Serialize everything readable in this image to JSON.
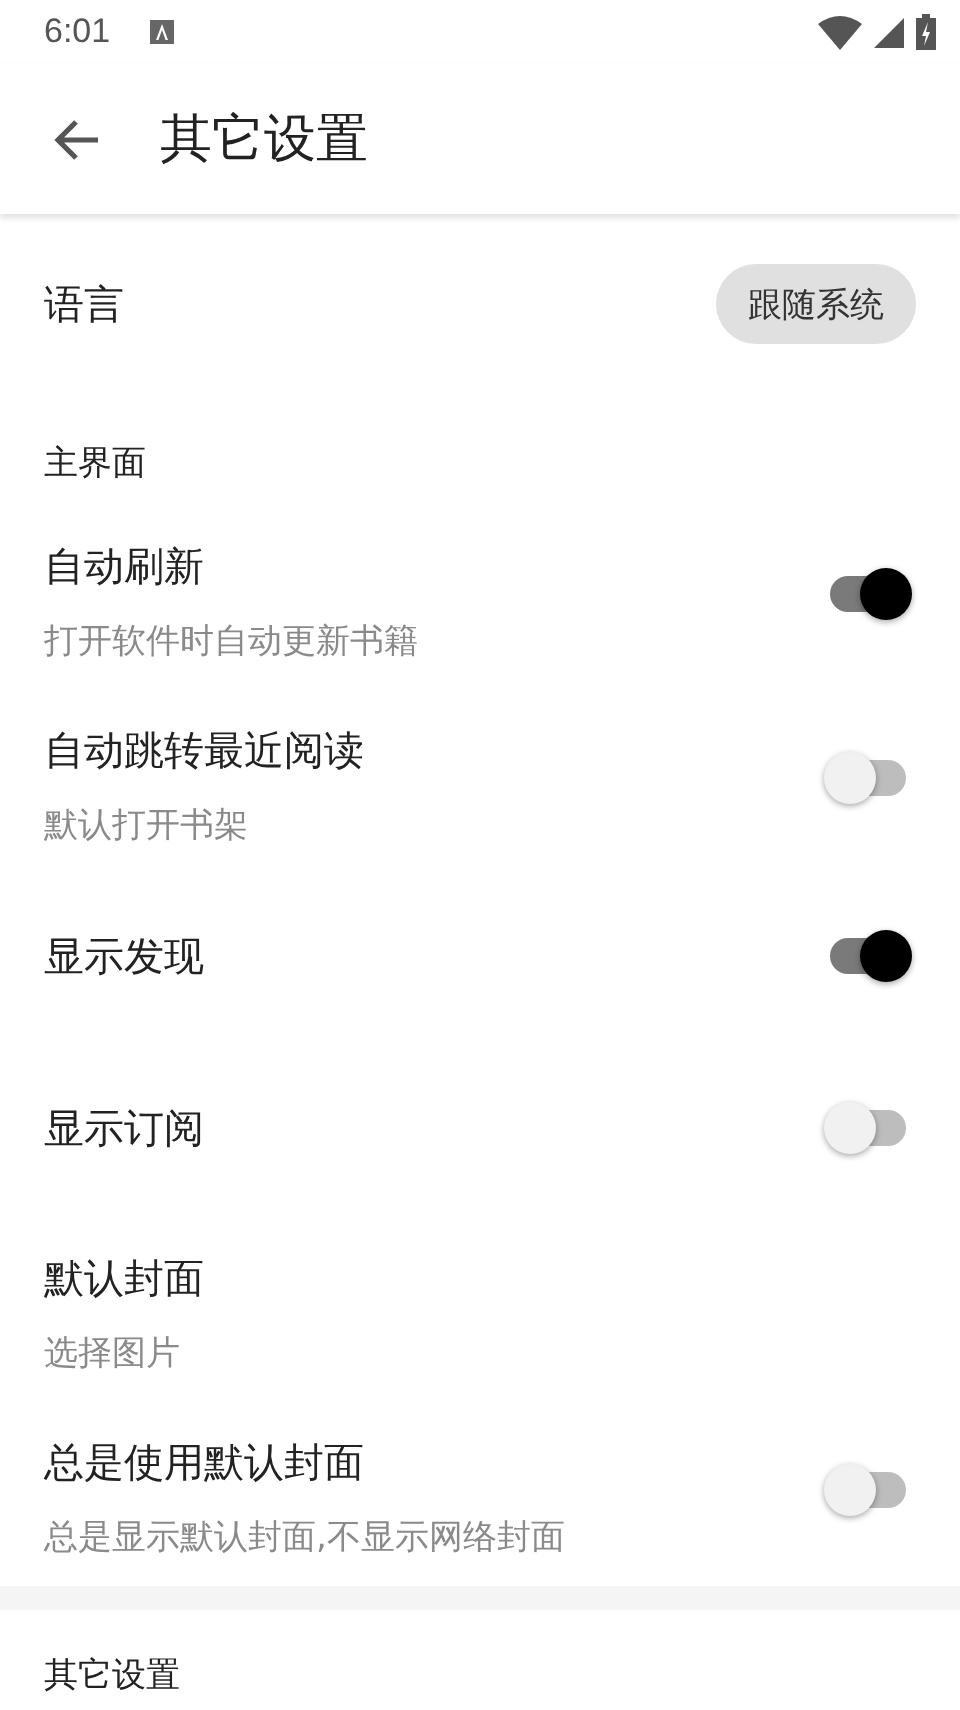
{
  "status_bar": {
    "time": "6:01"
  },
  "app_bar": {
    "title": "其它设置"
  },
  "language": {
    "label": "语言",
    "value": "跟随系统"
  },
  "sections": [
    {
      "title": "主界面",
      "items": [
        {
          "kind": "switch",
          "title": "自动刷新",
          "summary": "打开软件时自动更新书籍",
          "on": true
        },
        {
          "kind": "switch",
          "title": "自动跳转最近阅读",
          "summary": "默认打开书架",
          "on": false
        },
        {
          "kind": "switch",
          "title": "显示发现",
          "on": true
        },
        {
          "kind": "switch",
          "title": "显示订阅",
          "on": false
        },
        {
          "kind": "plain",
          "title": "默认封面",
          "summary": "选择图片"
        },
        {
          "kind": "switch",
          "title": "总是使用默认封面",
          "summary": "总是显示默认封面,不显示网络封面",
          "on": false
        }
      ]
    },
    {
      "title": "其它设置"
    }
  ]
}
